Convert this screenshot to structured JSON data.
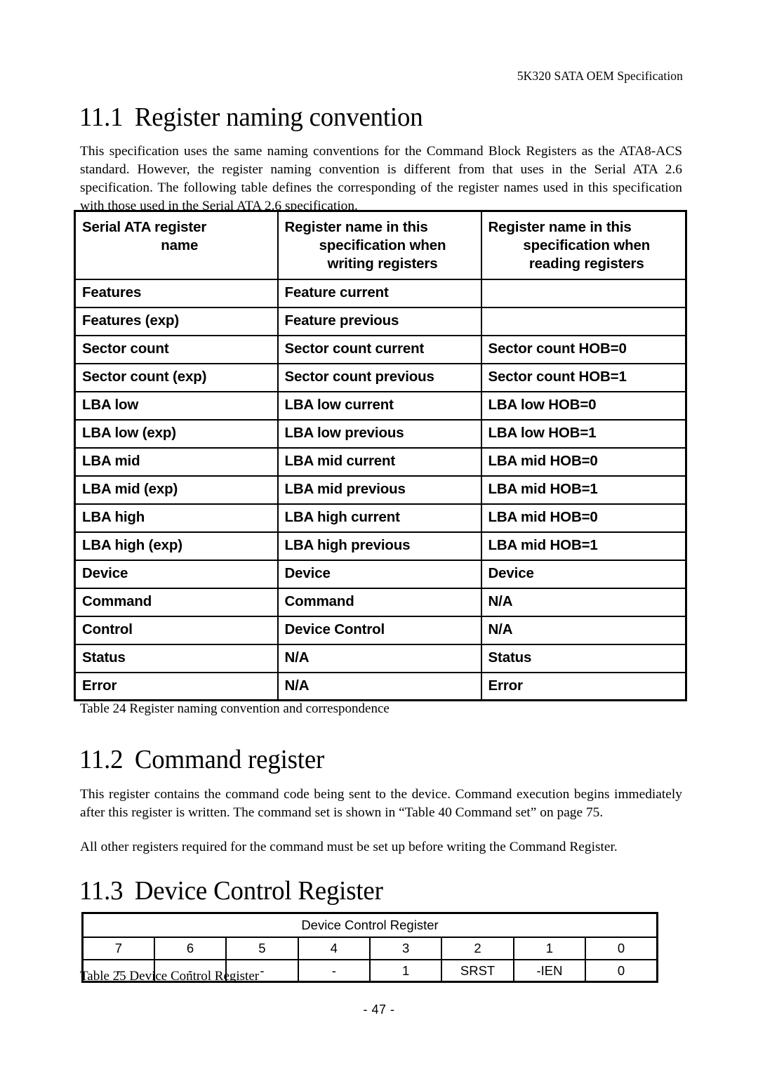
{
  "document": {
    "running_header": "5K320 SATA OEM Specification",
    "page_number": "- 47 -"
  },
  "sections": [
    {
      "number": "11.1",
      "title": "Register naming convention",
      "paragraphs": [
        "This specification uses the same naming conventions for the Command Block Registers as the ATA8-ACS standard. However, the register naming convention is different from that uses in the Serial ATA 2.6 specification. The following table defines the corresponding of the register names used in this specification with those used in the Serial ATA 2.6 specification."
      ]
    },
    {
      "number": "11.2",
      "title": "Command register",
      "paragraphs": [
        "This register contains the command code being sent to the device. Command execution begins immediately after this register is written. The command set is shown in  “Table 40 Command set” on page 75.",
        "All other registers required for the command must be set up before writing the Command Register."
      ]
    },
    {
      "number": "11.3",
      "title": "Device Control Register",
      "paragraphs": []
    }
  ],
  "register_table": {
    "caption": "Table 24 Register naming convention and correspondence",
    "headers": [
      [
        "Serial ATA register",
        "name"
      ],
      [
        "Register name in this",
        "specification when",
        "writing registers"
      ],
      [
        "Register name in this",
        "specification when",
        "reading registers"
      ]
    ],
    "rows": [
      [
        "Features",
        "Feature current",
        ""
      ],
      [
        "Features (exp)",
        "Feature previous",
        ""
      ],
      [
        "Sector count",
        "Sector count current",
        "Sector count HOB=0"
      ],
      [
        "Sector count (exp)",
        "Sector count previous",
        "Sector count HOB=1"
      ],
      [
        "LBA low",
        "LBA low current",
        "LBA low HOB=0"
      ],
      [
        "LBA low (exp)",
        "LBA low previous",
        "LBA low HOB=1"
      ],
      [
        "LBA mid",
        "LBA mid current",
        "LBA mid HOB=0"
      ],
      [
        "LBA mid (exp)",
        "LBA mid previous",
        "LBA mid HOB=1"
      ],
      [
        "LBA high",
        "LBA high current",
        "LBA mid HOB=0"
      ],
      [
        "LBA high (exp)",
        "LBA high previous",
        "LBA mid HOB=1"
      ],
      [
        "Device",
        "Device",
        "Device"
      ],
      [
        "Command",
        "Command",
        "N/A"
      ],
      [
        "Control",
        "Device Control",
        "N/A"
      ],
      [
        "Status",
        "N/A",
        "Status"
      ],
      [
        "Error",
        "N/A",
        "Error"
      ]
    ]
  },
  "device_control_register_table": {
    "caption": "Table 25 Device Control Register",
    "title": "Device Control Register",
    "bit_numbers": [
      "7",
      "6",
      "5",
      "4",
      "3",
      "2",
      "1",
      "0"
    ],
    "bit_values": [
      "-",
      "-",
      "-",
      "-",
      "1",
      "SRST",
      "-IEN",
      "0"
    ]
  }
}
